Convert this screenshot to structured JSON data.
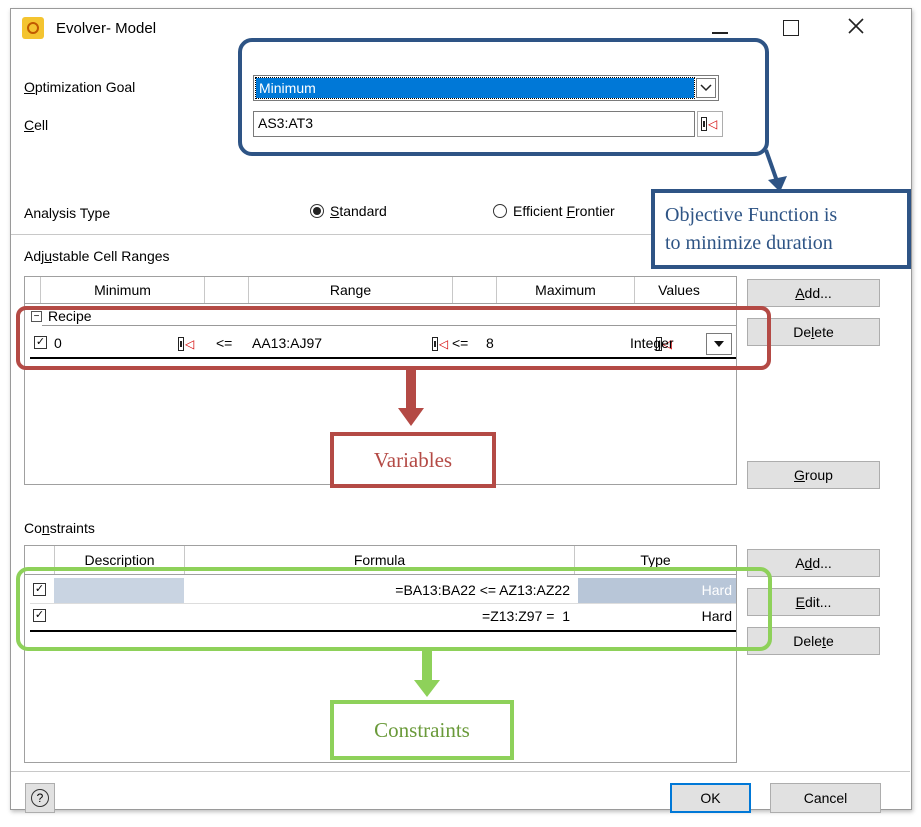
{
  "window": {
    "title": "Evolver- Model"
  },
  "goal": {
    "label_prefix": "O",
    "label_rest": "ptimization Goal",
    "value": "Minimum"
  },
  "cell": {
    "label_prefix": "C",
    "label_rest": "ell",
    "value": "AS3:AT3"
  },
  "analysis": {
    "label": "Analysis Type",
    "standard_prefix": "S",
    "standard_rest": "tandard",
    "frontier_prefix": "Efficient ",
    "frontier_u": "F",
    "frontier_rest": "rontier"
  },
  "adjustable": {
    "title_a": "Adj",
    "title_u": "u",
    "title_b": "stable Cell Ranges",
    "columns": [
      "Minimum",
      "Range",
      "Maximum",
      "Values"
    ],
    "group_label": "Recipe",
    "row": {
      "min": "0",
      "op1": "<=",
      "range": "AA13:AJ97",
      "op2": "<=",
      "max": "8",
      "values": "Integer"
    },
    "add_prefix": "A",
    "add_rest": "dd...",
    "delete_a": "De",
    "delete_u": "l",
    "delete_b": "ete",
    "group_u": "G",
    "group_rest": "roup"
  },
  "constraints": {
    "title_a": "Co",
    "title_u": "n",
    "title_b": "straints",
    "columns": [
      "Description",
      "Formula",
      "Type"
    ],
    "rows": [
      {
        "description": "",
        "formula": "=BA13:BA22 <= AZ13:AZ22",
        "type": "Hard"
      },
      {
        "description": "",
        "formula": "=Z13:Z97 =  1",
        "type": "Hard"
      }
    ],
    "add_a": "A",
    "add_u": "d",
    "add_b": "d...",
    "edit_u": "E",
    "edit_rest": "dit...",
    "delete_a": "Dele",
    "delete_u": "t",
    "delete_b": "e"
  },
  "footer": {
    "help": "?",
    "ok": "OK",
    "cancel": "Cancel"
  },
  "annotations": {
    "objective_line1": "Objective Function is",
    "objective_line2": "to minimize duration",
    "variables": "Variables",
    "constraints": "Constraints"
  },
  "colors": {
    "blue": "#2e5485",
    "red": "#b44a45",
    "green": "#8ed15a",
    "selection": "#0078d7"
  }
}
